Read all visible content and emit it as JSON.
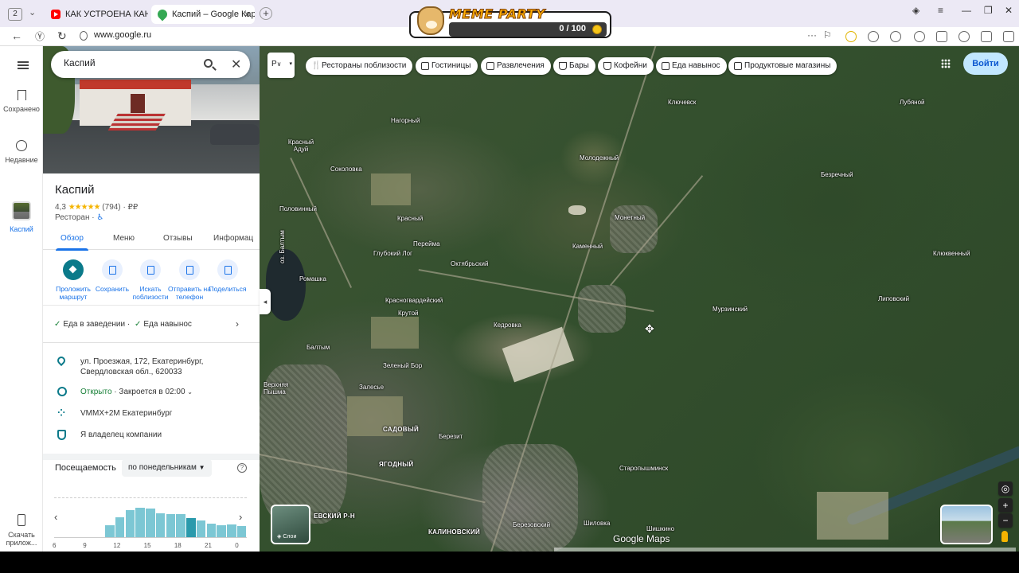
{
  "browser": {
    "tab_count": "2",
    "tabs": [
      {
        "label": "КАК УСТРОЕНА КАНАЛИ",
        "icon": "youtube-icon"
      },
      {
        "label": "Каспий – Google Карты",
        "icon": "google-maps-icon"
      }
    ],
    "url": "www.google.ru"
  },
  "meme_party": {
    "title": "MEME PARTY",
    "score": "0 / 100"
  },
  "rail": {
    "saved": "Сохранено",
    "recent": "Недавние",
    "place": "Каспий",
    "download": "Скачать прилож..."
  },
  "search": {
    "value": "Каспий"
  },
  "place": {
    "name": "Каспий",
    "rating": "4,3",
    "stars": "★★★★★",
    "reviews": "(794)",
    "price": "· ₽₽",
    "category": "Ресторан ·"
  },
  "tabs": [
    "Обзор",
    "Меню",
    "Отзывы",
    "Информац"
  ],
  "actions": [
    {
      "label": "Проложить маршрут"
    },
    {
      "label": "Сохранить"
    },
    {
      "label": "Искать поблизости"
    },
    {
      "label": "Отправить на телефон"
    },
    {
      "label": "Поделиться"
    }
  ],
  "services": {
    "item1": "Еда в заведении ·",
    "item2": "Еда навынос"
  },
  "info": {
    "address": "ул. Проезжая, 172, Екатеринбург, Свердловская обл., 620033",
    "open_status": "Открыто",
    "closes": " · Закроется в 02:00",
    "plus_code": "VMMX+2M Екатеринбург",
    "owner": "Я владелец компании"
  },
  "popular_times": {
    "title": "Посещаемость",
    "day": "по понедельникам",
    "help": "?"
  },
  "chart_data": {
    "type": "bar",
    "title": "",
    "ticks": [
      "6",
      "9",
      "12",
      "15",
      "18",
      "21",
      "0"
    ],
    "values": [
      0,
      0,
      0,
      0,
      0,
      33,
      55,
      75,
      80,
      78,
      65,
      62,
      62,
      52,
      45,
      38,
      32,
      35,
      30
    ],
    "current_index": 13,
    "ylim": [
      0,
      100
    ]
  },
  "map": {
    "layer_short": "Р",
    "chips": [
      "Рестораны поблизости",
      "Гостиницы",
      "Развлечения",
      "Бары",
      "Кофейни",
      "Еда навынос",
      "Продуктовые магазины"
    ],
    "signin": "Войти",
    "layers_label": "Слои",
    "logo": "Google Maps",
    "labels": [
      "Ключевск",
      "Лубяной",
      "Нагорный",
      "Красный Адуй",
      "Молодежный",
      "Соколовка",
      "Безречный",
      "Половинный",
      "Монетный",
      "Красный",
      "Перейма",
      "Глубокий Лог",
      "Каменный",
      "Октябрьский",
      "Клюквенный",
      "оз. Балтым",
      "Ромашка",
      "Мурзинский",
      "Красногвардейский",
      "Крутой",
      "Липовский",
      "Кедровка",
      "Балтым",
      "Зеленый Бор",
      "Верхняя Пышма",
      "Залесье",
      "САДОВЫЙ",
      "Березит",
      "ЯГОДНЫЙ",
      "Старопышминск",
      "ЕВСКИЙ Р-Н",
      "КАЛИНОВСКИЙ",
      "Березовский",
      "Шиловка",
      "Шишкино"
    ]
  }
}
